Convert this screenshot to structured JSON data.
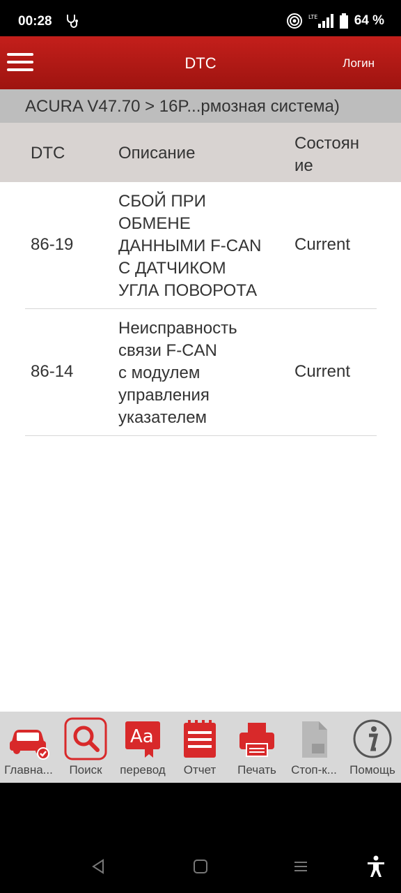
{
  "status_bar": {
    "time": "00:28",
    "battery": "64 %",
    "network": "LTE"
  },
  "header": {
    "title": "DTC",
    "login": "Логин"
  },
  "breadcrumb": "ACURA V47.70 > 16P...рмозная система)",
  "table": {
    "columns": [
      "DTC",
      "Описание",
      "Состояние"
    ],
    "column_state_lines": [
      "Состоян",
      "ие"
    ],
    "rows": [
      {
        "code": "86-19",
        "description_lines": [
          "СБОЙ ПРИ",
          "ОБМЕНЕ",
          "ДАННЫМИ F-CAN",
          "С ДАТЧИКОМ",
          "УГЛА ПОВОРОТА"
        ],
        "state": "Current"
      },
      {
        "code": "86-14",
        "description_lines": [
          "Неисправность",
          "связи F-CAN",
          "с модулем",
          "управления",
          "указателем"
        ],
        "state": "Current"
      }
    ]
  },
  "toolbar": [
    {
      "label": "Главна...",
      "icon": "car-check-icon"
    },
    {
      "label": "Поиск",
      "icon": "search-icon"
    },
    {
      "label": "перевод",
      "icon": "translate-icon"
    },
    {
      "label": "Отчет",
      "icon": "report-icon"
    },
    {
      "label": "Печать",
      "icon": "print-icon"
    },
    {
      "label": "Стоп-к...",
      "icon": "document-icon"
    },
    {
      "label": "Помощь",
      "icon": "info-icon"
    }
  ],
  "colors": {
    "brand_red": "#c41f1b",
    "disabled_gray": "#b0b0b0"
  }
}
